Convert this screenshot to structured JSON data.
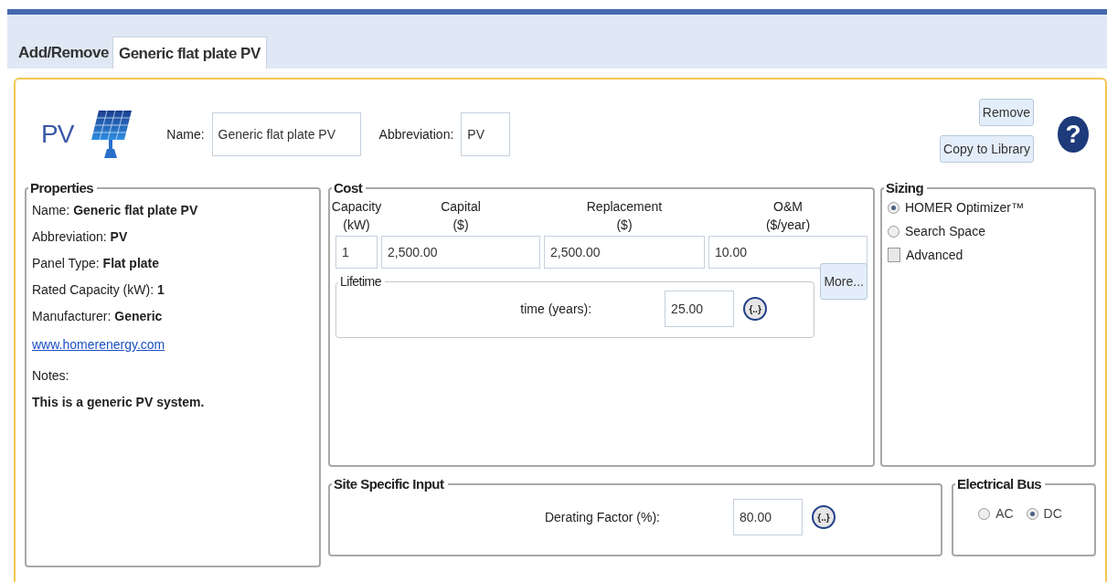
{
  "tabs": [
    {
      "label": "Add/Remove",
      "selected": false
    },
    {
      "label": "Generic flat plate PV",
      "selected": true
    }
  ],
  "header": {
    "title": "PV",
    "name_label": "Name:",
    "name_value": "Generic flat plate PV",
    "abbreviation_label": "Abbreviation:",
    "abbreviation_value": "PV",
    "buttons": [
      "Remove",
      "Copy to Library"
    ],
    "help": "?"
  },
  "properties": {
    "title": "Properties",
    "rows": [
      {
        "label": "Name:",
        "value": "Generic flat plate PV"
      },
      {
        "label": "Abbreviation:",
        "value": "PV"
      },
      {
        "label": "Panel Type:",
        "value": "Flat plate"
      },
      {
        "label": "Rated Capacity (kW):",
        "value": "1"
      },
      {
        "label": "Manufacturer:",
        "value": "Generic"
      }
    ],
    "link": "www.homerenergy.com",
    "notes_label": "Notes:",
    "notes": "This is a generic PV system."
  },
  "cost": {
    "title": "Cost",
    "columns": [
      {
        "label": "Capacity",
        "unit": "(kW)",
        "value": "1"
      },
      {
        "label": "Capital",
        "unit": "($)",
        "value": "2,500.00"
      },
      {
        "label": "Replacement",
        "unit": "($)",
        "value": "2,500.00"
      },
      {
        "label": "O&M",
        "unit": "($/year)",
        "value": "10.00"
      }
    ],
    "lifetime": {
      "title": "Lifetime",
      "label": "time (years):",
      "value": "25.00",
      "sensitivity": "{..}"
    },
    "more_button": "More..."
  },
  "sizing": {
    "title": "Sizing",
    "options": [
      {
        "kind": "radio",
        "label": "HOMER Optimizer™",
        "selected": true
      },
      {
        "kind": "radio",
        "label": "Search Space",
        "selected": false
      },
      {
        "kind": "checkbox",
        "label": "Advanced",
        "checked": false
      }
    ]
  },
  "site": {
    "title": "Site Specific Input",
    "label": "Derating Factor (%):",
    "value": "80.00",
    "sensitivity": "{..}"
  },
  "bus": {
    "title": "Electrical Bus",
    "options": [
      {
        "label": "AC",
        "selected": false
      },
      {
        "label": "DC",
        "selected": true
      }
    ]
  }
}
